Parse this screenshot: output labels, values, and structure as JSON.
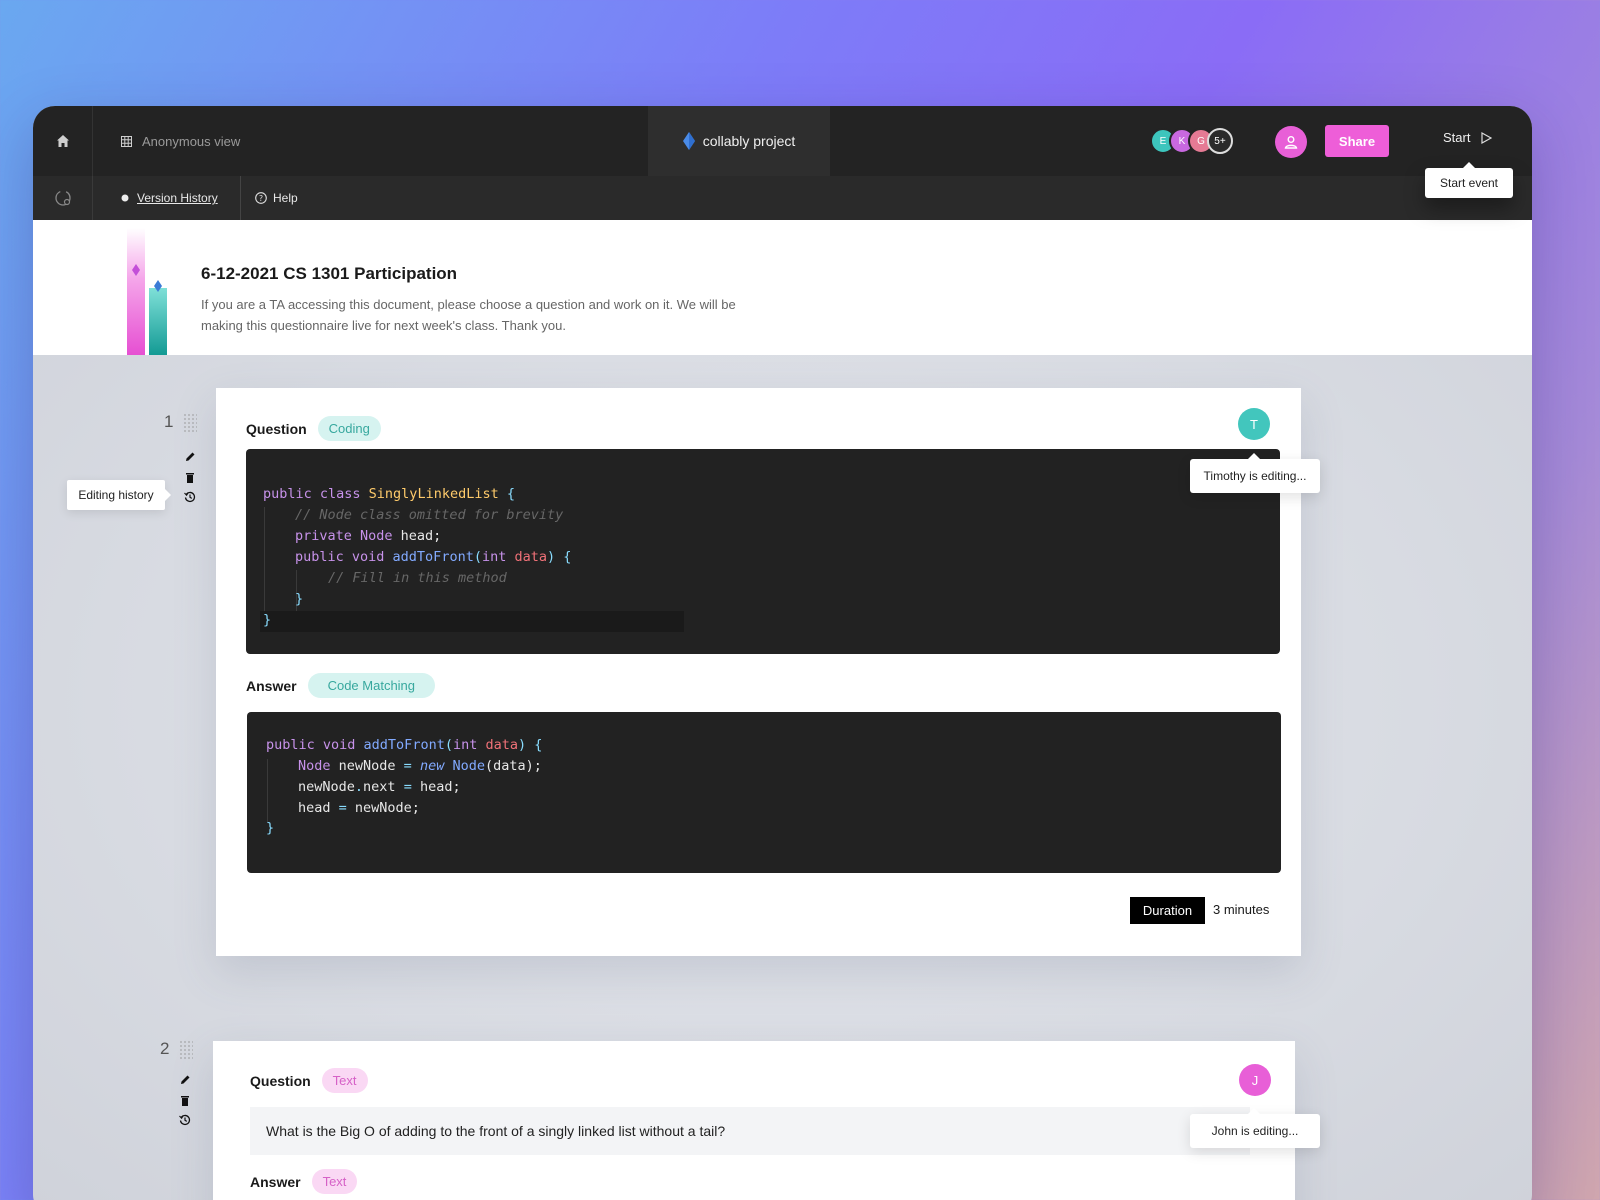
{
  "topbar": {
    "anonymous_view": "Anonymous view",
    "project_name": "collably project",
    "collaborators": [
      {
        "initial": "E",
        "color": "#3dc5bd"
      },
      {
        "initial": "K",
        "color": "#c868e0"
      },
      {
        "initial": "G",
        "color": "#e57a94"
      },
      {
        "initial": "5+",
        "color": "#2a2a2a"
      }
    ],
    "share_label": "Share",
    "start_label": "Start",
    "start_tooltip": "Start event"
  },
  "subbar": {
    "version_history": "Version History",
    "help": "Help"
  },
  "document": {
    "title": "6-12-2021 CS 1301 Participation",
    "description": "If you are a TA accessing this document, please choose a question and work on it. We will be making this questionnaire live for next week's class. Thank you."
  },
  "editing_history_tooltip": "Editing history",
  "questions": [
    {
      "number": "1",
      "question_label": "Question",
      "question_type": "Coding",
      "editor_initial": "T",
      "editor_color": "#42c6bd",
      "editing_text": "Timothy is editing...",
      "question_code": [
        "public class SinglyLinkedList {",
        "// Node class omitted for brevity",
        "private Node head;",
        "public void addToFront(int data) {",
        "// Fill in this method",
        "}",
        "}"
      ],
      "answer_label": "Answer",
      "answer_type": "Code Matching",
      "answer_code": [
        "public void addToFront(int data) {",
        "Node newNode = new Node(data);",
        "newNode.next = head;",
        "head = newNode;",
        "}"
      ],
      "duration_label": "Duration",
      "duration_value": "3 minutes"
    },
    {
      "number": "2",
      "question_label": "Question",
      "question_type": "Text",
      "editor_initial": "J",
      "editor_color": "#e85fd7",
      "editing_text": "John is editing...",
      "question_text": "What is the Big O of adding to the front of a singly linked list without a tail?",
      "answer_label": "Answer",
      "answer_type": "Text"
    }
  ]
}
